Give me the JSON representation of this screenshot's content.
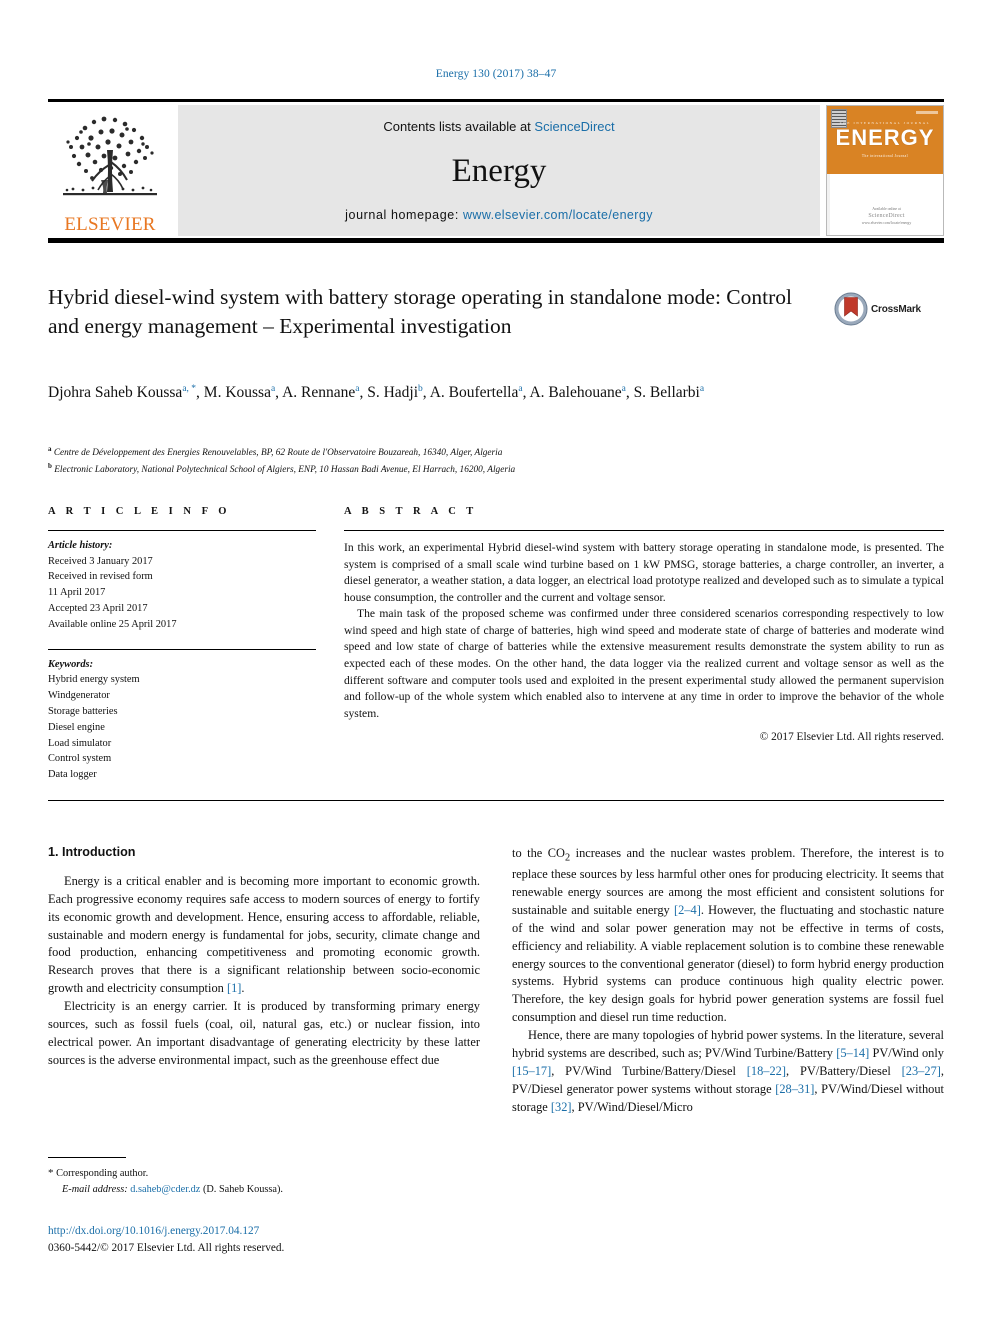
{
  "running_head": "Energy 130 (2017) 38–47",
  "masthead": {
    "publisher_name": "ELSEVIER",
    "contents_prefix": "Contents lists available at",
    "contents_link": "ScienceDirect",
    "journal_name": "Energy",
    "homepage_prefix": "journal homepage:",
    "homepage_link": "www.elsevier.com/locate/energy",
    "cover": {
      "title": "ENERGY",
      "microtext_top": "THE INTERNATIONAL JOURNAL",
      "tagline": "The international Journal",
      "footer_prefix": "Available online at",
      "footer_brand": "ScienceDirect",
      "footer_url": "www.elsevier.com/locate/energy"
    }
  },
  "article": {
    "title": "Hybrid diesel-wind system with battery storage operating in standalone mode: Control and energy management – Experimental investigation",
    "crossmark_label": "CrossMark",
    "authors_line1": "Djohra Saheb Koussa ",
    "authors": [
      {
        "name": "Djohra Saheb Koussa",
        "sup": "a, *"
      },
      {
        "name": "M. Koussa",
        "sup": "a"
      },
      {
        "name": "A. Rennane",
        "sup": "a"
      },
      {
        "name": "S. Hadji",
        "sup": "b"
      },
      {
        "name": "A. Boufertella",
        "sup": "a"
      },
      {
        "name": "A. Balehouane",
        "sup": "a"
      },
      {
        "name": "S. Bellarbi",
        "sup": "a"
      }
    ],
    "affiliations": [
      {
        "marker": "a",
        "text": "Centre de Développement des Energies Renouvelables, BP, 62 Route de l'Observatoire Bouzareah, 16340, Alger, Algeria"
      },
      {
        "marker": "b",
        "text": "Electronic Laboratory, National Polytechnical School of Algiers, ENP, 10 Hassan Badi Avenue, El Harrach, 16200, Algeria"
      }
    ]
  },
  "article_info": {
    "heading": "A R T I C L E   I N F O",
    "history_label": "Article history:",
    "history": [
      "Received 3 January 2017",
      "Received in revised form",
      "11 April 2017",
      "Accepted 23 April 2017",
      "Available online 25 April 2017"
    ],
    "keywords_label": "Keywords:",
    "keywords": [
      "Hybrid energy system",
      "Windgenerator",
      "Storage batteries",
      "Diesel engine",
      "Load simulator",
      "Control system",
      "Data logger"
    ]
  },
  "abstract": {
    "heading": "A B S T R A C T",
    "paragraph1": "In this work, an experimental Hybrid diesel-wind system with battery storage operating in standalone mode, is presented. The system is comprised of a small scale wind turbine based on 1 kW PMSG, storage batteries, a charge controller, an inverter, a diesel generator, a weather station, a data logger, an electrical load prototype realized and developed such as to simulate a typical house consumption, the controller and the current and voltage sensor.",
    "paragraph2": "The main task of the proposed scheme was confirmed under three considered scenarios corresponding respectively to low wind speed and high state of charge of batteries, high wind speed and moderate state of charge of batteries and moderate wind speed and low state of charge of batteries while the extensive measurement results demonstrate the system ability to run as expected each of these modes. On the other hand, the data logger via the realized current and voltage sensor as well as the different software and computer tools used and exploited in the present experimental study allowed the permanent supervision and follow-up of the whole system which enabled also to intervene at any time in order to improve the behavior of the whole system.",
    "copyright": "© 2017 Elsevier Ltd. All rights reserved."
  },
  "body": {
    "section_title": "1. Introduction",
    "left": {
      "p1": "Energy is a critical enabler and is becoming more important to economic growth. Each progressive economy requires safe access to modern sources of energy to fortify its economic growth and development. Hence, ensuring access to affordable, reliable, sustainable and modern energy is fundamental for jobs, security, climate change and food production, enhancing competitiveness and promoting economic growth. Research proves that there is a significant relationship between socio-economic growth and electricity consumption ",
      "p1_ref": "[1]",
      "p1_end": ".",
      "p2": "Electricity is an energy carrier. It is produced by transforming primary energy sources, such as fossil fuels (coal, oil, natural gas, etc.) or nuclear fission, into electrical power. An important disadvantage of generating electricity by these latter sources is the adverse environmental impact, such as the greenhouse effect due"
    },
    "right": {
      "p1_a": "to the CO",
      "p1_sub": "2",
      "p1_b": " increases and the nuclear wastes problem. Therefore, the interest is to replace these sources by less harmful other ones for producing electricity. It seems that renewable energy sources are among the most efficient and consistent solutions for sustainable and suitable energy ",
      "p1_ref": "[2–4]",
      "p1_c": ". However, the fluctuating and stochastic nature of the wind and solar power generation may not be effective in terms of costs, efficiency and reliability. A viable replacement solution is to combine these renewable energy sources to the conventional generator (diesel) to form hybrid energy production systems. Hybrid systems can produce continuous high quality electric power. Therefore, the key design goals for hybrid power generation systems are fossil fuel consumption and diesel run time reduction.",
      "p2_a": "Hence, there are many topologies of hybrid power systems. In the literature, several hybrid systems are described, such as; PV/Wind Turbine/Battery ",
      "p2_r1": "[5–14]",
      "p2_b": " PV/Wind only ",
      "p2_r2": "[15–17]",
      "p2_c": ", PV/Wind Turbine/Battery/Diesel ",
      "p2_r3": "[18–22]",
      "p2_d": ", PV/Battery/Diesel ",
      "p2_r4": "[23–27]",
      "p2_e": ", PV/Diesel generator power systems without storage ",
      "p2_r5": "[28–31]",
      "p2_f": ", PV/Wind/Diesel without storage ",
      "p2_r6": "[32]",
      "p2_g": ", PV/Wind/Diesel/Micro"
    }
  },
  "footnote": {
    "star": "*",
    "corresponding": "Corresponding author.",
    "email_label": "E-mail address:",
    "email": "d.saheb@cder.dz",
    "email_suffix": "(D. Saheb Koussa)."
  },
  "page_footer": {
    "doi": "http://dx.doi.org/10.1016/j.energy.2017.04.127",
    "issn": "0360-5442/© 2017 Elsevier Ltd. All rights reserved."
  },
  "colors": {
    "link_blue": "#1a6ea8",
    "elsevier_orange": "#e87722",
    "cover_orange": "#d98324"
  }
}
